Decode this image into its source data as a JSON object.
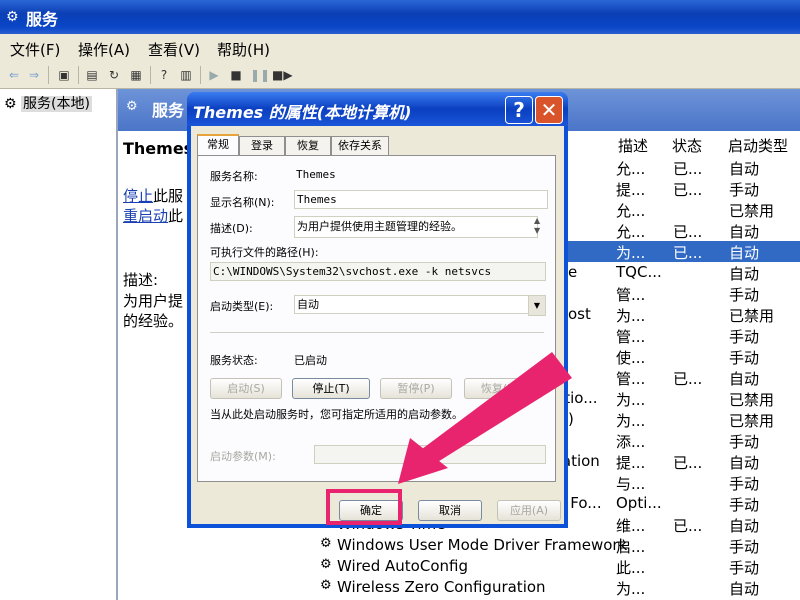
{
  "window": {
    "title": "服务",
    "icon": "gear-icon"
  },
  "menu": [
    "文件(F)",
    "操作(A)",
    "查看(V)",
    "帮助(H)"
  ],
  "tree": {
    "item": "服务(本地)"
  },
  "right_header": "服务",
  "desc_panel": {
    "title": "Themes",
    "stop": "停止",
    "stop_suffix": "此服",
    "restart": "重启动",
    "restart_suffix": "此",
    "desc_label": "描述:",
    "desc_text1": "为用户提",
    "desc_text2": "的经验。"
  },
  "columns": {
    "desc": "描述",
    "status": "状态",
    "startup": "启动类型"
  },
  "rows": [
    {
      "name": "",
      "desc": "允...",
      "status": "已...",
      "startup": "自动"
    },
    {
      "name": "",
      "desc": "提...",
      "status": "已...",
      "startup": "手动"
    },
    {
      "name": "",
      "desc": "允...",
      "status": "",
      "startup": "已禁用"
    },
    {
      "name": "",
      "desc": "允...",
      "status": "已...",
      "startup": "自动"
    },
    {
      "name": "",
      "desc": "为...",
      "status": "已...",
      "startup": "自动"
    },
    {
      "name": "e",
      "desc": "TQC...",
      "status": "",
      "startup": "自动"
    },
    {
      "name": "",
      "desc": "管...",
      "status": "",
      "startup": "手动"
    },
    {
      "name": "ost",
      "desc": "为...",
      "status": "",
      "startup": "已禁用"
    },
    {
      "name": "",
      "desc": "管...",
      "status": "",
      "startup": "手动"
    },
    {
      "name": "",
      "desc": "使...",
      "status": "",
      "startup": "手动"
    },
    {
      "name": "",
      "desc": "管...",
      "status": "已...",
      "startup": "自动"
    },
    {
      "name": "ctio...",
      "desc": "为...",
      "status": "",
      "startup": "已禁用"
    },
    {
      "name": ")",
      "desc": "为...",
      "status": "",
      "startup": "已禁用"
    },
    {
      "name": "",
      "desc": "添...",
      "status": "",
      "startup": "手动"
    },
    {
      "name": "tation",
      "desc": "提...",
      "status": "已...",
      "startup": "自动"
    },
    {
      "name": "",
      "desc": "与...",
      "status": "",
      "startup": "手动"
    },
    {
      "name": "n Fo...",
      "desc": "Opti...",
      "status": "",
      "startup": "手动"
    },
    {
      "name": "Windows Time",
      "desc": "维...",
      "status": "已...",
      "startup": "自动"
    },
    {
      "name": "Windows User Mode Driver Framework",
      "desc": "启...",
      "status": "",
      "startup": "手动"
    },
    {
      "name": "Wired AutoConfig",
      "desc": "此...",
      "status": "",
      "startup": "手动"
    },
    {
      "name": "Wireless Zero Configuration",
      "desc": "为...",
      "status": "",
      "startup": "自动"
    }
  ],
  "dialog": {
    "title": "Themes 的属性(本地计算机)",
    "help": "?",
    "close": "✕",
    "tabs": [
      "常规",
      "登录",
      "恢复",
      "依存关系"
    ],
    "service_name_label": "服务名称:",
    "service_name": "Themes",
    "display_name_label": "显示名称(N):",
    "display_name": "Themes",
    "desc_label": "描述(D):",
    "desc": "为用户提供使用主题管理的经验。",
    "path_label": "可执行文件的路径(H):",
    "path": "C:\\WINDOWS\\System32\\svchost.exe -k netsvcs",
    "startup_label": "启动类型(E):",
    "startup_value": "自动",
    "status_label": "服务状态:",
    "status_value": "已启动",
    "btn_start": "启动(S)",
    "btn_stop": "停止(T)",
    "btn_pause": "暂停(P)",
    "btn_resume": "恢复(R)",
    "hint": "当从此处启动服务时，您可指定所适用的启动参数。",
    "params_label": "启动参数(M):",
    "ok": "确定",
    "cancel": "取消",
    "apply": "应用(A)"
  },
  "highlight_color": "#e8246e"
}
